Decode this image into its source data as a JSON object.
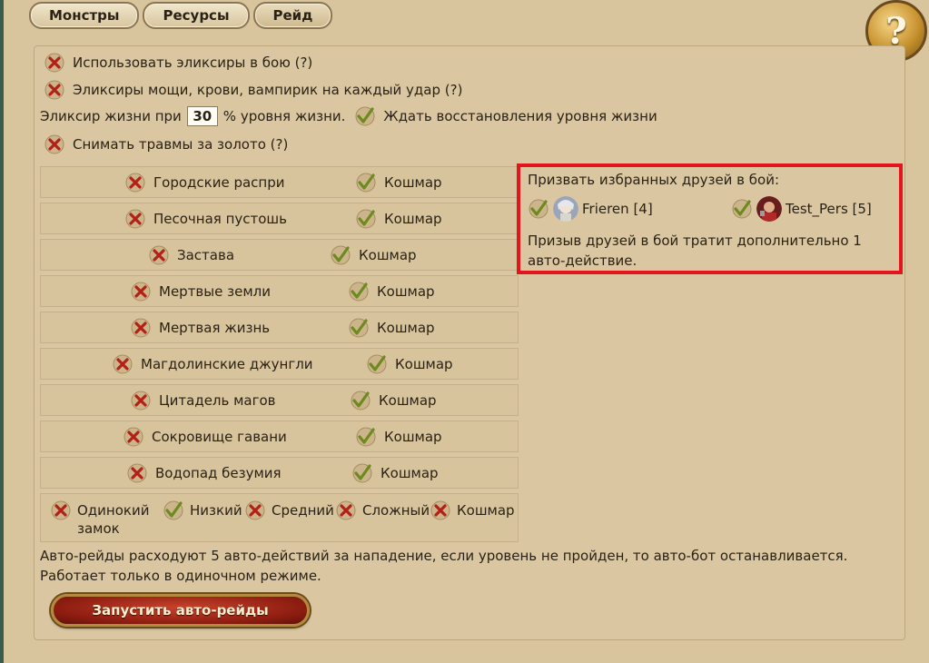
{
  "tabs": [
    {
      "label": "Монстры"
    },
    {
      "label": "Ресурсы"
    },
    {
      "label": "Рейд"
    }
  ],
  "help": {
    "label": "?"
  },
  "options": {
    "use_elixirs": "Использовать эликсиры в бою (?)",
    "power_elixirs": "Эликсиры мощи, крови, вампирик на каждый удар (?)",
    "life_elixir_prefix": "Эликсир жизни при",
    "life_elixir_value": "30",
    "life_elixir_suffix": "% уровня жизни.",
    "wait_recovery": "Ждать восстановления уровня жизни",
    "heal_gold": "Снимать травмы за золото (?)"
  },
  "locations": [
    {
      "name": "Городские распри",
      "mode": "Кошмар"
    },
    {
      "name": "Песочная пустошь",
      "mode": "Кошмар"
    },
    {
      "name": "Застава",
      "mode": "Кошмар"
    },
    {
      "name": "Мертвые земли",
      "mode": "Кошмар"
    },
    {
      "name": "Мертвая жизнь",
      "mode": "Кошмар"
    },
    {
      "name": "Магдолинские джунгли",
      "mode": "Кошмар"
    },
    {
      "name": "Цитадель магов",
      "mode": "Кошмар"
    },
    {
      "name": "Сокровище гавани",
      "mode": "Кошмар"
    },
    {
      "name": "Водопад безумия",
      "mode": "Кошмар"
    }
  ],
  "castle": {
    "name_line1": "Одинокий",
    "name_line2": "замок",
    "low": "Низкий",
    "medium": "Средний",
    "hard": "Сложный",
    "nightmare": "Кошмар"
  },
  "friends": {
    "title": "Призвать избранных друзей в бой:",
    "list": [
      {
        "name": "Frieren [4]"
      },
      {
        "name": "Test_Pers [5]"
      }
    ],
    "note": "Призыв друзей в бой тратит дополнительно 1 авто-действие."
  },
  "info": {
    "line1": "Авто-рейды расходуют 5 авто-действий за нападение, если уровень не пройден, то авто-бот останавливается.",
    "line2": "Работает только в одиночном режиме."
  },
  "launch_label": "Запустить авто-рейды"
}
